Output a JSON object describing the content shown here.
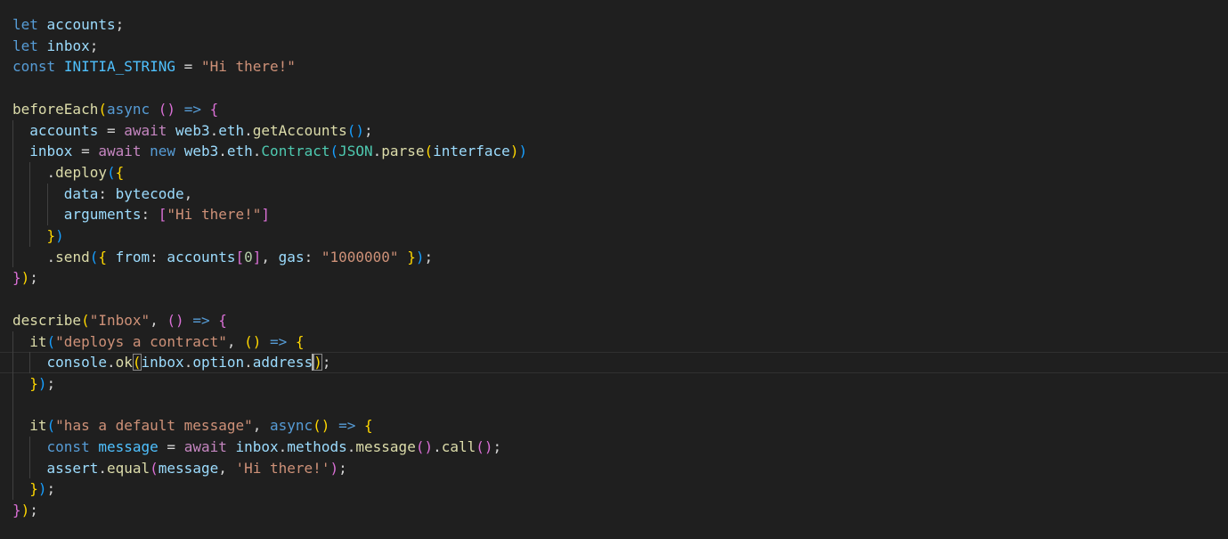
{
  "colors": {
    "background": "#1f1f1f",
    "keyword": "#569cd6",
    "control": "#c586c0",
    "variable": "#9cdcfe",
    "constant": "#4fc1ff",
    "function": "#dcdcaa",
    "class": "#4ec9b0",
    "string": "#ce9178",
    "number": "#b5cea8",
    "punct": "#d4d4d4",
    "bracket1": "#ffd700",
    "bracket2": "#da70d6",
    "bracket3": "#179fff"
  },
  "editor": {
    "cursor_line": 16,
    "lines": [
      {
        "indent": 0,
        "tokens": [
          [
            "let",
            "keyword"
          ],
          [
            " ",
            "punct"
          ],
          [
            "accounts",
            "variable"
          ],
          [
            ";",
            "punct"
          ]
        ]
      },
      {
        "indent": 0,
        "tokens": [
          [
            "let",
            "keyword"
          ],
          [
            " ",
            "punct"
          ],
          [
            "inbox",
            "variable"
          ],
          [
            ";",
            "punct"
          ]
        ]
      },
      {
        "indent": 0,
        "tokens": [
          [
            "const",
            "keyword"
          ],
          [
            " ",
            "punct"
          ],
          [
            "INITIA_STRING",
            "constant"
          ],
          [
            " = ",
            "punct"
          ],
          [
            "\"Hi there!\"",
            "string"
          ]
        ]
      },
      {
        "indent": 0,
        "tokens": []
      },
      {
        "indent": 0,
        "tokens": [
          [
            "beforeEach",
            "function"
          ],
          [
            "(",
            "bracket1"
          ],
          [
            "async",
            "keyword"
          ],
          [
            " ",
            "punct"
          ],
          [
            "()",
            "bracket2"
          ],
          [
            " ",
            "punct"
          ],
          [
            "=>",
            "keyword"
          ],
          [
            " ",
            "punct"
          ],
          [
            "{",
            "bracket2"
          ]
        ]
      },
      {
        "indent": 1,
        "tokens": [
          [
            "  ",
            "punct"
          ],
          [
            "accounts",
            "variable"
          ],
          [
            " = ",
            "punct"
          ],
          [
            "await",
            "control"
          ],
          [
            " ",
            "punct"
          ],
          [
            "web3",
            "variable"
          ],
          [
            ".",
            "punct"
          ],
          [
            "eth",
            "variable"
          ],
          [
            ".",
            "punct"
          ],
          [
            "getAccounts",
            "function"
          ],
          [
            "()",
            "bracket3"
          ],
          [
            ";",
            "punct"
          ]
        ]
      },
      {
        "indent": 1,
        "tokens": [
          [
            "  ",
            "punct"
          ],
          [
            "inbox",
            "variable"
          ],
          [
            " = ",
            "punct"
          ],
          [
            "await",
            "control"
          ],
          [
            " ",
            "punct"
          ],
          [
            "new",
            "keyword"
          ],
          [
            " ",
            "punct"
          ],
          [
            "web3",
            "variable"
          ],
          [
            ".",
            "punct"
          ],
          [
            "eth",
            "variable"
          ],
          [
            ".",
            "punct"
          ],
          [
            "Contract",
            "class"
          ],
          [
            "(",
            "bracket3"
          ],
          [
            "JSON",
            "class"
          ],
          [
            ".",
            "punct"
          ],
          [
            "parse",
            "function"
          ],
          [
            "(",
            "bracket1"
          ],
          [
            "interface",
            "variable"
          ],
          [
            ")",
            "bracket1"
          ],
          [
            ")",
            "bracket3"
          ]
        ]
      },
      {
        "indent": 2,
        "tokens": [
          [
            "    .",
            "punct"
          ],
          [
            "deploy",
            "function"
          ],
          [
            "(",
            "bracket3"
          ],
          [
            "{",
            "bracket1"
          ]
        ]
      },
      {
        "indent": 3,
        "tokens": [
          [
            "      ",
            "punct"
          ],
          [
            "data",
            "variable"
          ],
          [
            ": ",
            "punct"
          ],
          [
            "bytecode",
            "variable"
          ],
          [
            ",",
            "punct"
          ]
        ]
      },
      {
        "indent": 3,
        "tokens": [
          [
            "      ",
            "punct"
          ],
          [
            "arguments",
            "variable"
          ],
          [
            ": ",
            "punct"
          ],
          [
            "[",
            "bracket2"
          ],
          [
            "\"Hi there!\"",
            "string"
          ],
          [
            "]",
            "bracket2"
          ]
        ]
      },
      {
        "indent": 2,
        "tokens": [
          [
            "    ",
            "punct"
          ],
          [
            "}",
            "bracket1"
          ],
          [
            ")",
            "bracket3"
          ]
        ]
      },
      {
        "indent": 1,
        "tokens": [
          [
            "    .",
            "punct"
          ],
          [
            "send",
            "function"
          ],
          [
            "(",
            "bracket3"
          ],
          [
            "{",
            "bracket1"
          ],
          [
            " ",
            "punct"
          ],
          [
            "from",
            "variable"
          ],
          [
            ": ",
            "punct"
          ],
          [
            "accounts",
            "variable"
          ],
          [
            "[",
            "bracket2"
          ],
          [
            "0",
            "number"
          ],
          [
            "]",
            "bracket2"
          ],
          [
            ", ",
            "punct"
          ],
          [
            "gas",
            "variable"
          ],
          [
            ": ",
            "punct"
          ],
          [
            "\"1000000\"",
            "string"
          ],
          [
            " ",
            "punct"
          ],
          [
            "}",
            "bracket1"
          ],
          [
            ")",
            "bracket3"
          ],
          [
            ";",
            "punct"
          ]
        ]
      },
      {
        "indent": 0,
        "tokens": [
          [
            "}",
            "bracket2"
          ],
          [
            ")",
            "bracket1"
          ],
          [
            ";",
            "punct"
          ]
        ]
      },
      {
        "indent": 0,
        "tokens": []
      },
      {
        "indent": 0,
        "tokens": [
          [
            "describe",
            "function"
          ],
          [
            "(",
            "bracket1"
          ],
          [
            "\"Inbox\"",
            "string"
          ],
          [
            ", ",
            "punct"
          ],
          [
            "()",
            "bracket2"
          ],
          [
            " ",
            "punct"
          ],
          [
            "=>",
            "keyword"
          ],
          [
            " ",
            "punct"
          ],
          [
            "{",
            "bracket2"
          ]
        ]
      },
      {
        "indent": 1,
        "tokens": [
          [
            "  ",
            "punct"
          ],
          [
            "it",
            "function"
          ],
          [
            "(",
            "bracket3"
          ],
          [
            "\"deploys a contract\"",
            "string"
          ],
          [
            ", ",
            "punct"
          ],
          [
            "()",
            "bracket1"
          ],
          [
            " ",
            "punct"
          ],
          [
            "=>",
            "keyword"
          ],
          [
            " ",
            "punct"
          ],
          [
            "{",
            "bracket1"
          ]
        ]
      },
      {
        "indent": 2,
        "tokens": [
          [
            "    ",
            "punct"
          ],
          [
            "console",
            "variable"
          ],
          [
            ".",
            "punct"
          ],
          [
            "ok",
            "function"
          ],
          [
            "(",
            "bm"
          ],
          [
            "inbox",
            "variable"
          ],
          [
            ".",
            "punct"
          ],
          [
            "option",
            "variable"
          ],
          [
            ".",
            "punct"
          ],
          [
            "address",
            "variable"
          ],
          [
            "|",
            "cursor"
          ],
          [
            ")",
            "bm"
          ],
          [
            ";",
            "punct"
          ]
        ]
      },
      {
        "indent": 1,
        "tokens": [
          [
            "  ",
            "punct"
          ],
          [
            "}",
            "bracket1"
          ],
          [
            ")",
            "bracket3"
          ],
          [
            ";",
            "punct"
          ]
        ]
      },
      {
        "indent": 1,
        "tokens": []
      },
      {
        "indent": 1,
        "tokens": [
          [
            "  ",
            "punct"
          ],
          [
            "it",
            "function"
          ],
          [
            "(",
            "bracket3"
          ],
          [
            "\"has a default message\"",
            "string"
          ],
          [
            ", ",
            "punct"
          ],
          [
            "async",
            "keyword"
          ],
          [
            "()",
            "bracket1"
          ],
          [
            " ",
            "punct"
          ],
          [
            "=>",
            "keyword"
          ],
          [
            " ",
            "punct"
          ],
          [
            "{",
            "bracket1"
          ]
        ]
      },
      {
        "indent": 2,
        "tokens": [
          [
            "    ",
            "punct"
          ],
          [
            "const",
            "keyword"
          ],
          [
            " ",
            "punct"
          ],
          [
            "message",
            "constant"
          ],
          [
            " = ",
            "punct"
          ],
          [
            "await",
            "control"
          ],
          [
            " ",
            "punct"
          ],
          [
            "inbox",
            "variable"
          ],
          [
            ".",
            "punct"
          ],
          [
            "methods",
            "variable"
          ],
          [
            ".",
            "punct"
          ],
          [
            "message",
            "function"
          ],
          [
            "()",
            "bracket2"
          ],
          [
            ".",
            "punct"
          ],
          [
            "call",
            "function"
          ],
          [
            "()",
            "bracket2"
          ],
          [
            ";",
            "punct"
          ]
        ]
      },
      {
        "indent": 2,
        "tokens": [
          [
            "    ",
            "punct"
          ],
          [
            "assert",
            "variable"
          ],
          [
            ".",
            "punct"
          ],
          [
            "equal",
            "function"
          ],
          [
            "(",
            "bracket2"
          ],
          [
            "message",
            "variable"
          ],
          [
            ", ",
            "punct"
          ],
          [
            "'Hi there!'",
            "string"
          ],
          [
            ")",
            "bracket2"
          ],
          [
            ";",
            "punct"
          ]
        ]
      },
      {
        "indent": 1,
        "tokens": [
          [
            "  ",
            "punct"
          ],
          [
            "}",
            "bracket1"
          ],
          [
            ")",
            "bracket3"
          ],
          [
            ";",
            "punct"
          ]
        ]
      },
      {
        "indent": 0,
        "tokens": [
          [
            "}",
            "bracket2"
          ],
          [
            ")",
            "bracket1"
          ],
          [
            ";",
            "punct"
          ]
        ]
      }
    ]
  }
}
